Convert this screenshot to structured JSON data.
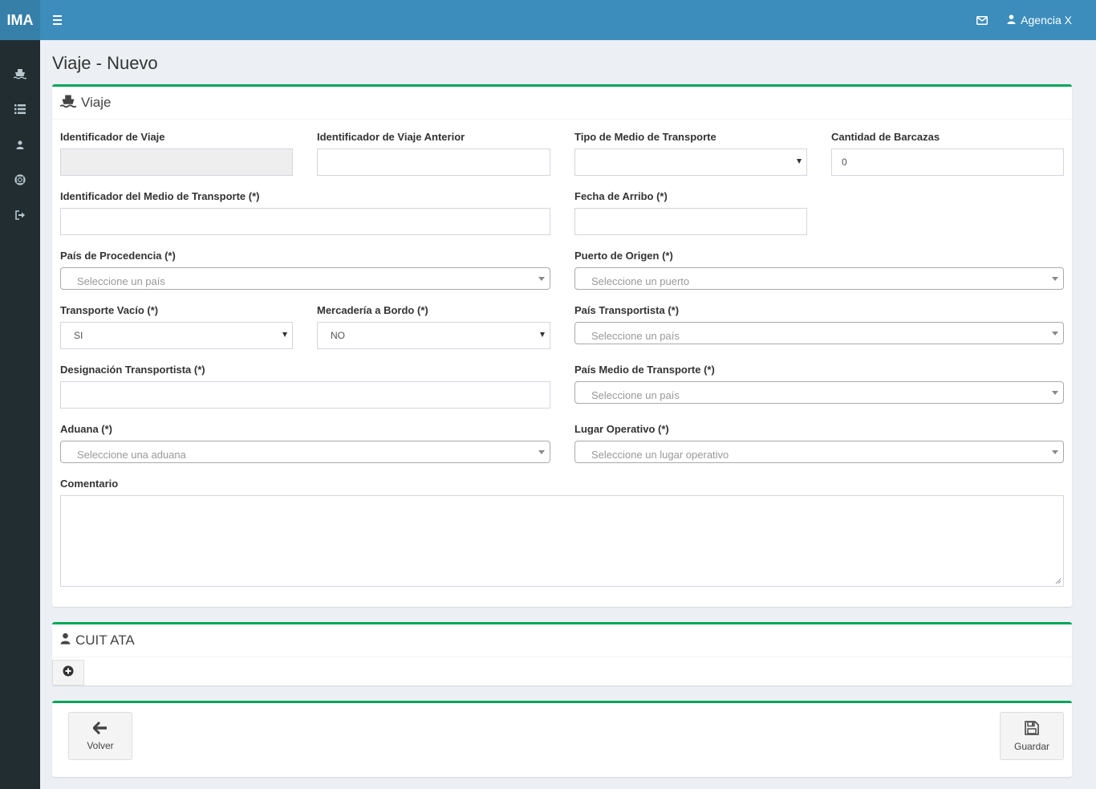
{
  "brand": {
    "logo": "IMA"
  },
  "header": {
    "user_name": "Agencia X"
  },
  "page": {
    "title": "Viaje - Nuevo"
  },
  "viaje_section": {
    "title": "Viaje",
    "fields": {
      "id_viaje": {
        "label": "Identificador de Viaje",
        "value": ""
      },
      "id_viaje_anterior": {
        "label": "Identificador de Viaje Anterior",
        "value": ""
      },
      "tipo_medio": {
        "label": "Tipo de Medio de Transporte",
        "value": ""
      },
      "cant_barcazas": {
        "label": "Cantidad de Barcazas",
        "value": "0"
      },
      "id_medio": {
        "label": "Identificador del Medio de Transporte (*)",
        "value": ""
      },
      "fecha_arribo": {
        "label": "Fecha de Arribo (*)",
        "value": ""
      },
      "pais_procedencia": {
        "label": "País de Procedencia (*)",
        "placeholder": "Seleccione un país"
      },
      "puerto_origen": {
        "label": "Puerto de Origen (*)",
        "placeholder": "Seleccione un puerto"
      },
      "transporte_vacio": {
        "label": "Transporte Vacío (*)",
        "value": "SI"
      },
      "mercaderia_bordo": {
        "label": "Mercadería a Bordo (*)",
        "value": "NO"
      },
      "pais_transportista": {
        "label": "País Transportista (*)",
        "placeholder": "Seleccione un país"
      },
      "designacion_transportista": {
        "label": "Designación Transportista (*)",
        "value": ""
      },
      "pais_medio": {
        "label": "País Medio de Transporte (*)",
        "placeholder": "Seleccione un país"
      },
      "aduana": {
        "label": "Aduana (*)",
        "placeholder": "Seleccione una aduana"
      },
      "lugar_operativo": {
        "label": "Lugar Operativo (*)",
        "placeholder": "Seleccione un lugar operativo"
      },
      "comentario": {
        "label": "Comentario",
        "value": ""
      }
    }
  },
  "cuit_section": {
    "title": "CUIT ATA"
  },
  "actions": {
    "back_label": "Volver",
    "save_label": "Guardar"
  },
  "colors": {
    "header": "#3c8dbc",
    "logo_bg": "#367fa9",
    "sidebar": "#222d32",
    "box_accent": "#00a65a"
  },
  "icons": {
    "sidebar": [
      "ship-icon",
      "list-icon",
      "user-icon",
      "lifebuoy-icon",
      "sign-out-icon"
    ],
    "header": [
      "envelope-icon",
      "user-icon"
    ]
  }
}
